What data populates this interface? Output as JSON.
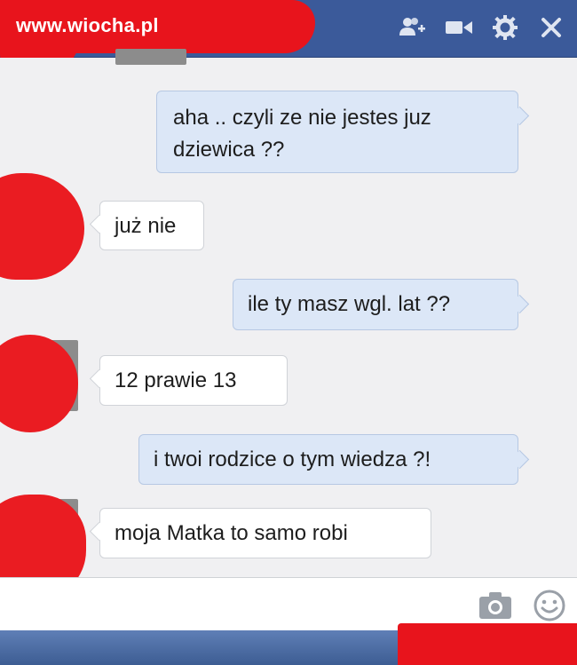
{
  "watermark": "www.wiocha.pl",
  "header": {
    "icons": [
      "add-friend-icon",
      "video-call-icon",
      "settings-gear-icon",
      "close-icon"
    ]
  },
  "messages": [
    {
      "sender": "me",
      "text": "aha .. czyli ze nie jestes juz dziewica ??"
    },
    {
      "sender": "them",
      "text": "już nie"
    },
    {
      "sender": "me",
      "text": "ile ty masz wgl. lat ??"
    },
    {
      "sender": "them",
      "text": "12 prawie 13"
    },
    {
      "sender": "me",
      "text": "i twoi rodzice o tym wiedza ?!"
    },
    {
      "sender": "them",
      "text": "moja Matka to samo robi"
    }
  ],
  "input_bar": {
    "icons": [
      "camera-icon",
      "emoji-icon"
    ]
  },
  "colors": {
    "header": "#3b5a9a",
    "my_bubble": "#dce7f7",
    "their_bubble": "#ffffff",
    "redaction": "#e8141c"
  }
}
